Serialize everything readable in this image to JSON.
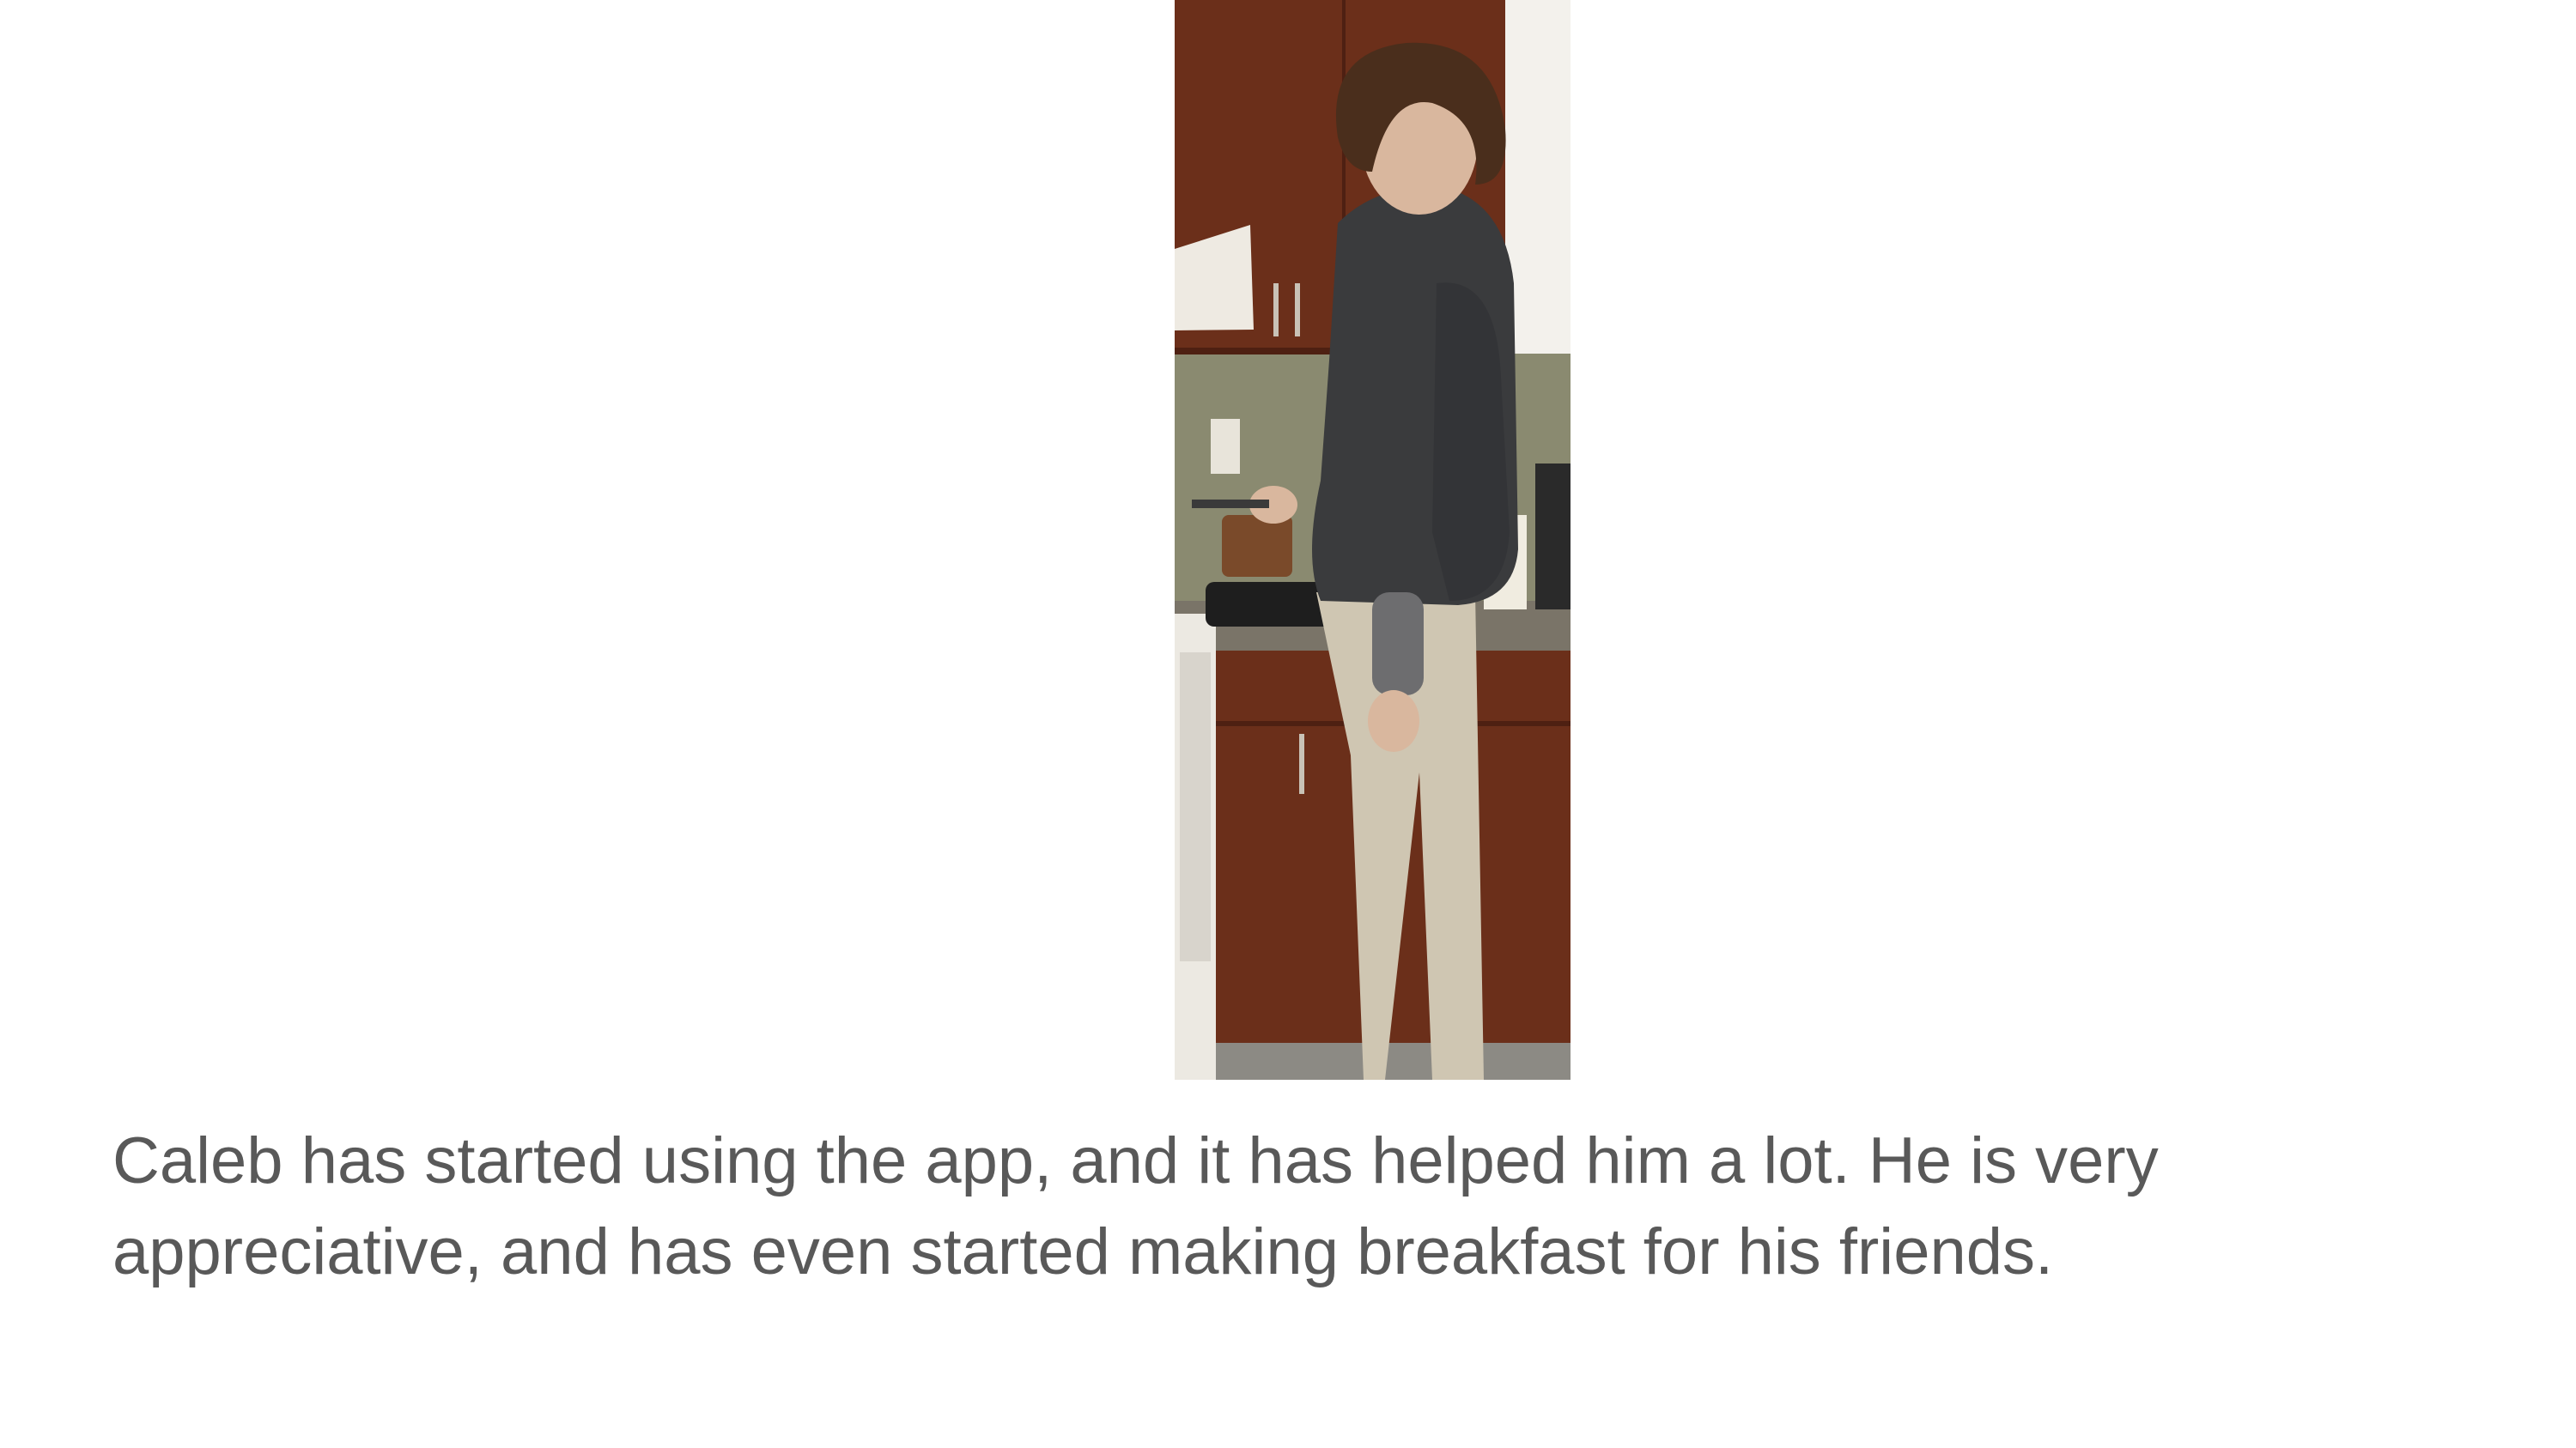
{
  "slide": {
    "caption": "Caleb has started using the app, and it has helped him a lot. He is very appreciative, and has even started making breakfast for his friends."
  },
  "photo": {
    "icon": "person-cooking-photo",
    "colors": {
      "cabinet": "#6b2f1a",
      "cabinet_dark": "#4e2012",
      "wall": "#8a8a70",
      "countertop": "#7a7468",
      "hoodie": "#3a3b3d",
      "pants": "#cfc6b2",
      "hair": "#4a2e1c",
      "skin": "#d9b79e"
    }
  }
}
